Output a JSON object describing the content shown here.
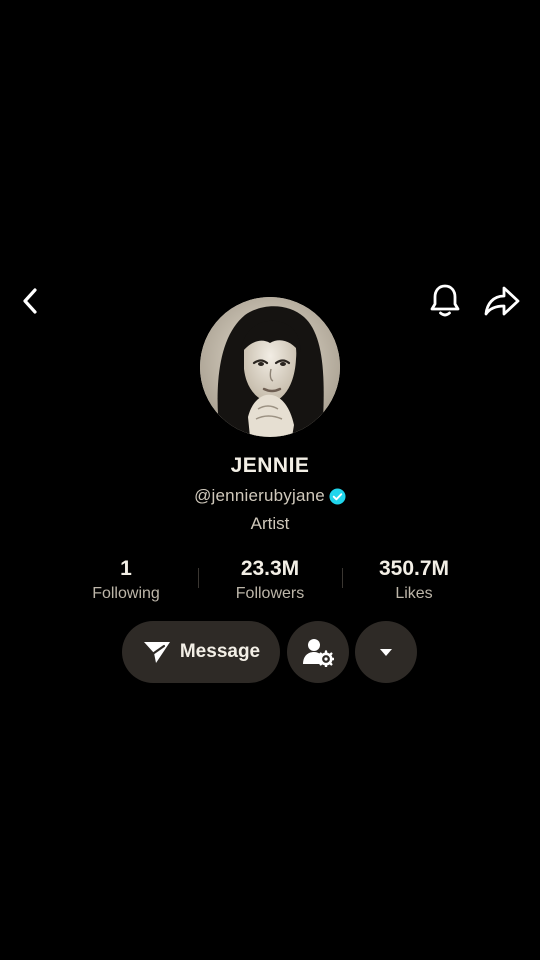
{
  "profile": {
    "name": "JENNIE",
    "handle": "@jennierubyjane",
    "bio": "Artist",
    "verified": true
  },
  "stats": [
    {
      "value": "1",
      "label": "Following"
    },
    {
      "value": "23.3M",
      "label": "Followers"
    },
    {
      "value": "350.7M",
      "label": "Likes"
    }
  ],
  "actions": {
    "message_label": "Message"
  },
  "icons": {
    "back": "chevron-left-icon",
    "notifications": "bell-icon",
    "share": "share-arrow-icon",
    "message": "paper-plane-icon",
    "friends": "user-settings-icon",
    "more": "caret-down-icon",
    "verified": "verified-badge-icon"
  },
  "colors": {
    "background": "#000000",
    "button": "#2e2a26",
    "text_primary": "#f3efe6",
    "text_secondary": "#cfc8bb",
    "verified": "#20d5ec"
  }
}
